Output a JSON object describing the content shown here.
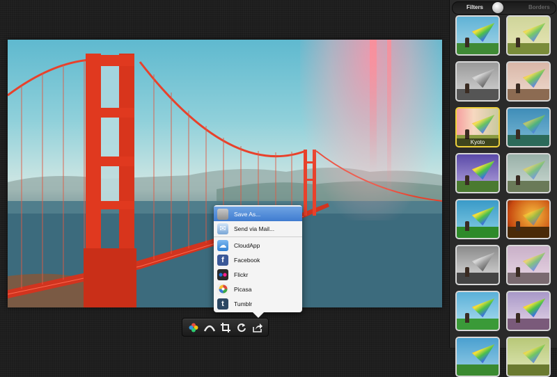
{
  "colors": {
    "accent_selection": "#3f7bd0",
    "selected_thumb_border": "#f0d23a",
    "bridge": "#e8412b"
  },
  "toolbar": {
    "tools": [
      {
        "name": "color-wheel-icon"
      },
      {
        "name": "exposure-icon"
      },
      {
        "name": "crop-icon"
      },
      {
        "name": "rotate-icon"
      },
      {
        "name": "share-icon"
      }
    ]
  },
  "share_menu": {
    "items": [
      {
        "label": "Save As...",
        "icon": "save-icon",
        "selected": true
      },
      {
        "label": "Send via Mail...",
        "icon": "mail-icon"
      },
      {
        "label": "CloudApp",
        "icon": "cloudapp-icon"
      },
      {
        "label": "Facebook",
        "icon": "facebook-icon"
      },
      {
        "label": "Flickr",
        "icon": "flickr-icon"
      },
      {
        "label": "Picasa",
        "icon": "picasa-icon"
      },
      {
        "label": "Tumblr",
        "icon": "tumblr-icon"
      }
    ]
  },
  "panel": {
    "segment": {
      "filters": "Filters",
      "borders": "Borders"
    },
    "selected_filter": "Kyoto",
    "thumbs": 16
  }
}
